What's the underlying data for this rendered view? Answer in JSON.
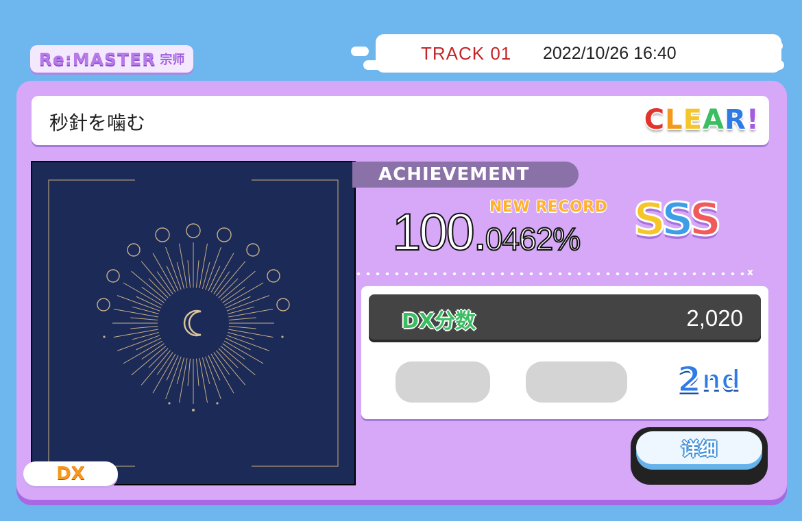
{
  "difficulty": {
    "name": "Re:MASTER",
    "sub": "宗师",
    "color": "#b77be8"
  },
  "track": {
    "label": "TRACK 01",
    "datetime": "2022/10/26 16:40"
  },
  "song": {
    "title": "秒針を噛む",
    "type": "DX"
  },
  "clear": {
    "label": "CLEAR!",
    "letter_colors": [
      "#e2342c",
      "#f39a1a",
      "#f5c52a",
      "#3bbd62",
      "#2f7be6",
      "#a35de0"
    ]
  },
  "achievement": {
    "header": "ACHIEVEMENT",
    "new_record": "NEW RECORD",
    "integer_part": "100.",
    "decimal_part": "0462%",
    "rank": "SSS"
  },
  "dx_score": {
    "label": "DX分数",
    "value": "2,020"
  },
  "placement": {
    "number": "2",
    "suffix": "nd"
  },
  "buttons": {
    "detail": "详细"
  },
  "icons": [
    "cover-art",
    "moon-icon",
    "cloud-shape"
  ]
}
